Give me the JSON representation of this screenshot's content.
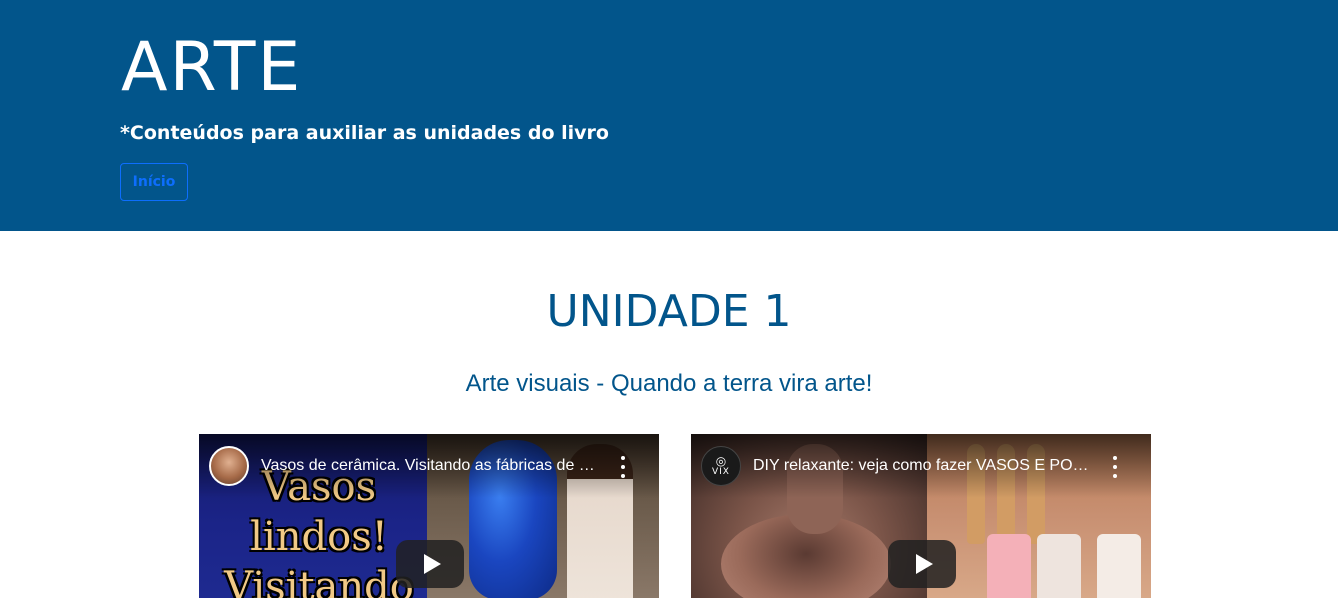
{
  "header": {
    "title": "ARTE",
    "subtitle": "*Conteúdos para auxiliar as unidades do livro",
    "home_button": "Início"
  },
  "unit": {
    "title": "UNIDADE 1",
    "subtitle": "Arte visuais - Quando a terra vira arte!"
  },
  "videos": [
    {
      "title": "Vasos de cerâmica. Visitando as fábricas de vasos",
      "thumbnail_text": "Vasos lindos! Visitando",
      "channel_avatar": "avatar-woman",
      "menu_icon": "more-vert-icon",
      "play_icon": "play-icon"
    },
    {
      "title": "DIY relaxante: veja como fazer VASOS E POTES",
      "channel_logo_text": "VIX",
      "channel_logo_mark": "◎",
      "menu_icon": "more-vert-icon",
      "play_icon": "play-icon"
    }
  ],
  "colors": {
    "header_bg": "#02558b",
    "heading": "#02558b",
    "button_outline": "#0d6efd"
  }
}
